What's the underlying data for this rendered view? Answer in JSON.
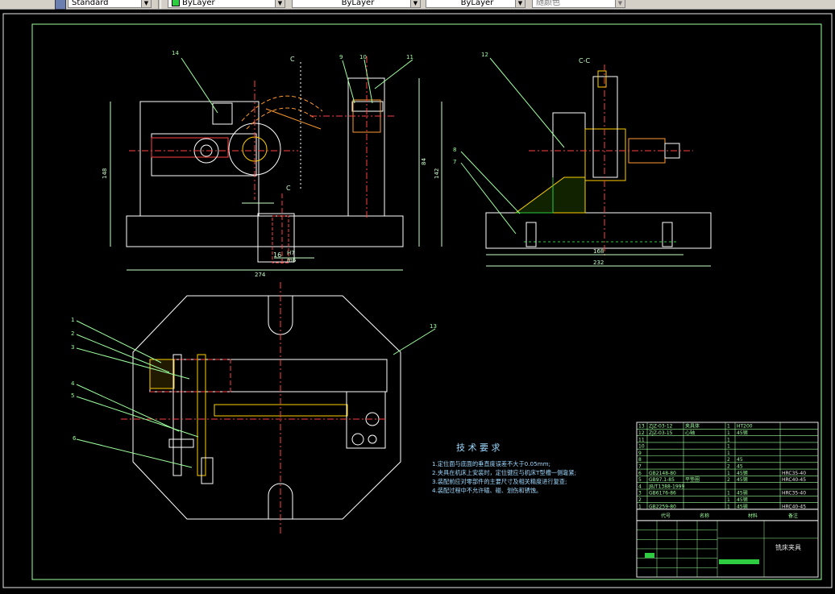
{
  "toolbar": {
    "textstyle": "Standard",
    "layer": "ByLayer",
    "linetype": "ByLayer",
    "lineweight": "ByLayer",
    "plotstyle": "随颜色"
  },
  "drawing": {
    "view_label_cc": "C-C",
    "section_letter": "C",
    "fit_label": "16",
    "fit_upper": "H7",
    "fit_lower": "m6",
    "dims": {
      "w274": "274",
      "h148": "148",
      "h84": "84",
      "w168": "168",
      "w232": "232",
      "h142": "142"
    },
    "callouts": [
      "1",
      "2",
      "3",
      "4",
      "5",
      "6",
      "7",
      "8",
      "9",
      "10",
      "11",
      "12",
      "13",
      "14"
    ],
    "tech_title": "技 术 要 求",
    "tech_lines": [
      "1.定位面与底面的垂直度误差不大于0.05mm;",
      "2.夹具在机床上安装时，定位键应与机床T型槽一侧靠紧;",
      "3.装配前应对零部件的主要尺寸及相关精度进行复查;",
      "4.装配过程中不允许磕、碰、划伤和锈蚀。"
    ]
  },
  "bom": {
    "rows": [
      [
        "13",
        "ZJZ-03-12",
        "夹具体",
        "1",
        "HT200",
        ""
      ],
      [
        "12",
        "ZJZ-03-15",
        "心轴",
        "1",
        "45钢",
        ""
      ],
      [
        "11",
        "",
        "",
        "1",
        "",
        ""
      ],
      [
        "10",
        "",
        "",
        "1",
        "",
        ""
      ],
      [
        "9",
        "",
        "",
        "1",
        "",
        ""
      ],
      [
        "8",
        "",
        "",
        "2",
        "45",
        ""
      ],
      [
        "7",
        "",
        "",
        "2",
        "45",
        ""
      ],
      [
        "6",
        "GB2148-80",
        "",
        "1",
        "45钢",
        "HRC35-40"
      ],
      [
        "5",
        "GB97.1-85",
        "平垫圈",
        "2",
        "45钢",
        "HRC40-45"
      ],
      [
        "4",
        "JB/T1388-1999",
        "",
        "",
        "",
        ""
      ],
      [
        "3",
        "GB6176-86",
        "",
        "1",
        "45钢",
        "HRC35-40"
      ],
      [
        "2",
        "",
        "",
        "1",
        "45钢",
        ""
      ],
      [
        "1",
        "GB2259-80",
        "",
        "1",
        "45钢",
        "HRC40-45"
      ]
    ],
    "header": [
      "代号",
      "名称",
      "材料",
      "备注"
    ],
    "title": "铣床夹具"
  }
}
